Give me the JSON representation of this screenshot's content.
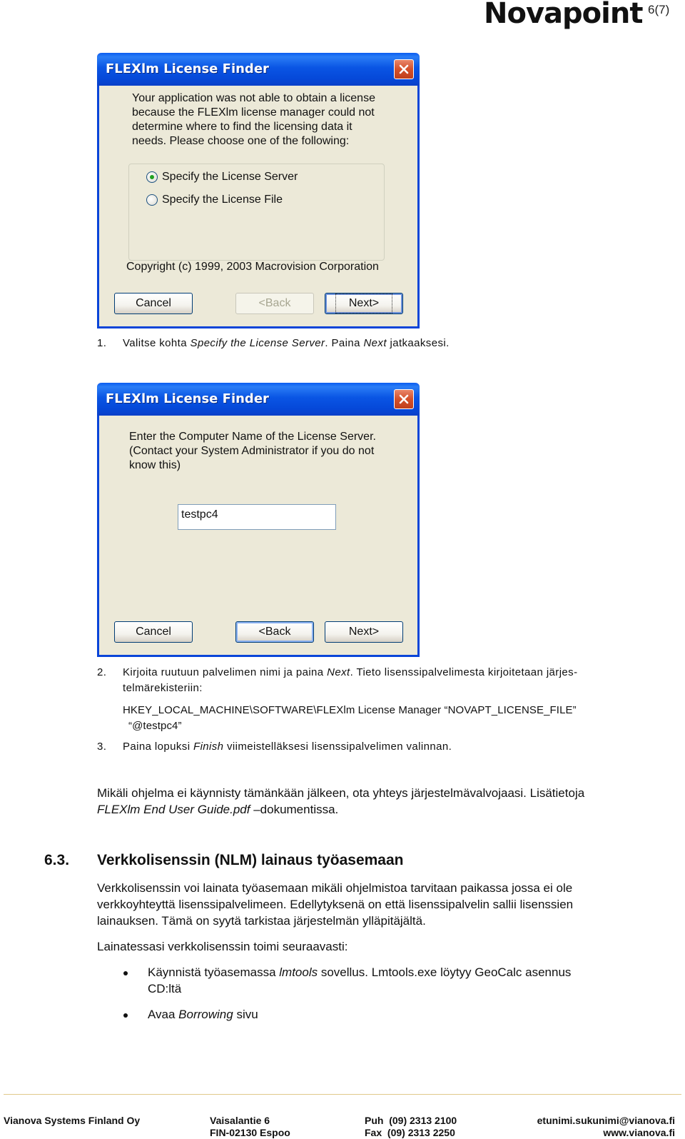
{
  "header": {
    "logo": "Novapoint",
    "page_number": "6(7)"
  },
  "dialog1": {
    "title": "FLEXlm License Finder",
    "close_icon": "close-x-icon",
    "message_lines": [
      "Your application was not able to obtain a license",
      "because the FLEXlm license manager could not",
      "determine where to find the licensing data it",
      "needs.  Please choose one of the following:"
    ],
    "options": [
      {
        "label": "Specify the License Server",
        "checked": true
      },
      {
        "label": "Specify the License File",
        "checked": false
      }
    ],
    "copyright": "Copyright (c) 1999, 2003 Macrovision Corporation",
    "buttons": {
      "cancel": "Cancel",
      "back": "<Back",
      "next": "Next>"
    }
  },
  "step1": {
    "num": "1.",
    "text_a": "Valitse kohta ",
    "text_italic": "Specify the License Server",
    "text_b": ". Paina ",
    "text_italic2": "Next",
    "text_c": " jatkaaksesi."
  },
  "dialog2": {
    "title": "FLEXlm License Finder",
    "message_lines": [
      "Enter the Computer Name of the License Server.",
      "(Contact your System Administrator if you do not",
      "know this)"
    ],
    "server_input_value": "testpc4",
    "buttons": {
      "cancel": "Cancel",
      "back": "<Back",
      "next": "Next>"
    }
  },
  "step2": {
    "num": "2.",
    "line1_a": "Kirjoita ruutuun palvelimen nimi ja paina ",
    "line1_italic": "Next",
    "line1_b": ". Tieto lisenssipalvelimesta kirjoitetaan järjes-",
    "line2": "telmärekisteriin:",
    "registry_line1": "HKEY_LOCAL_MACHINE\\SOFTWARE\\FLEXlm License Manager “NOVAPT_LICENSE_FILE”",
    "registry_line2": "“@testpc4”"
  },
  "step3": {
    "num": "3.",
    "text_a": "Paina lopuksi ",
    "text_italic": "Finish",
    "text_b": " viimeistelläksesi lisenssipalvelimen valinnan."
  },
  "note": {
    "line1": "Mikäli ohjelma ei käynnisty tämänkään jälkeen, ota yhteys järjestelmävalvojaasi. Lisätietoja",
    "line2_italic": "FLEXlm End User Guide.pdf",
    "line2_b": " –dokumentissa."
  },
  "section": {
    "number": "6.3.",
    "title": "Verkkolisenssin (NLM) lainaus työasemaan",
    "para_lines": [
      "Verkkolisenssin voi lainata työasemaan mikäli ohjelmistoa tarvitaan paikassa jossa ei ole",
      "verkkoyhteyttä lisenssipalvelimeen. Edellytyksenä on että lisenssipalvelin sallii lisenssien",
      "lainauksen. Tämä on syytä tarkistaa järjestelmän ylläpitäjältä."
    ],
    "intro": "Lainatessasi verkkolisenssin toimi seuraavasti:",
    "bullets": [
      {
        "a": "Käynnistä työasemassa ",
        "italic": "lmtools",
        "b": " sovellus. Lmtools.exe löytyy GeoCalc asennus",
        "line2": "CD:ltä"
      },
      {
        "a": "Avaa ",
        "italic": "Borrowing",
        "b": " sivu",
        "line2": ""
      }
    ]
  },
  "footer": {
    "company": "Vianova Systems Finland Oy",
    "address1": "Vaisalantie 6",
    "address2": "FIN-02130 Espoo",
    "phone": "Puh  (09) 2313 2100",
    "fax": "Fax  (09) 2313 2250",
    "email": "etunimi.sukunimi@vianova.fi",
    "web": "www.vianova.fi"
  }
}
